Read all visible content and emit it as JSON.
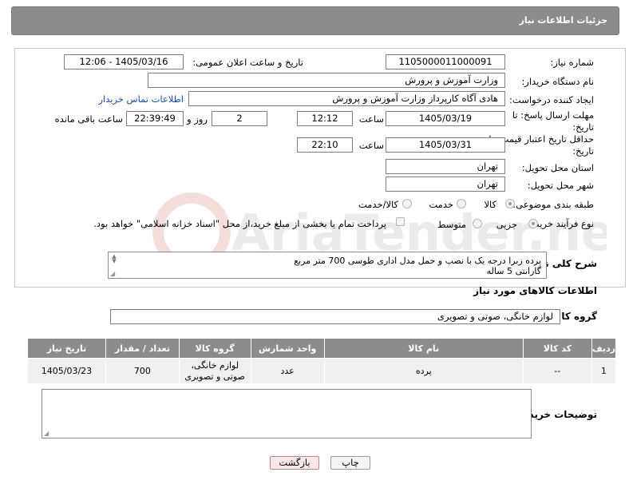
{
  "header": {
    "title": "جزئیات اطلاعات نیاز"
  },
  "form": {
    "need_number_label": "شماره نیاز:",
    "need_number": "1105000011000091",
    "announce_label": "تاریخ و ساعت اعلان عمومی:",
    "announce_value": "1405/03/16 - 12:06",
    "buyer_org_label": "نام دستگاه خریدار:",
    "buyer_org": "وزارت آموزش و پرورش",
    "creator_label": "ایجاد کننده درخواست:",
    "creator": "هادی آگاه کارپرداز وزارت آموزش و پرورش",
    "contact_link": "اطلاعات تماس خریدار",
    "reply_deadline_label": "مهلت ارسال پاسخ: تا تاریخ:",
    "reply_date": "1405/03/19",
    "time_label": "ساعت",
    "reply_time": "12:12",
    "days": "2",
    "days_label": "روز و",
    "remaining_time": "22:39:49",
    "remaining_label": "ساعت باقی مانده",
    "price_validity_label": "حداقل تاریخ اعتبار قیمت: تا تاریخ:",
    "price_date": "1405/03/31",
    "price_time": "22:10",
    "province_label": "استان محل تحویل:",
    "province": "تهران",
    "city_label": "شهر محل تحویل:",
    "city": "تهران",
    "category_label": "طبقه بندی موضوعی:",
    "category_options": [
      "کالا",
      "خدمت",
      "کالا/خدمت"
    ],
    "category_selected": "کالا",
    "process_label": "نوع فرآیند خرید :",
    "process_options": [
      "جزیی",
      "متوسط"
    ],
    "process_selected": "جزیی",
    "payment_note": "پرداخت تمام یا بخشی از مبلغ خرید،از محل \"اسناد خزانه اسلامی\" خواهد بود."
  },
  "description": {
    "label": "شرح کلی نیاز:",
    "line1": "پرده زبرا  درجه یک با نصب و حمل مدل اداری طوسی 700 متر مربع",
    "line2": "گارانتی 5 ساله"
  },
  "goods": {
    "section_title": "اطلاعات کالاهای مورد نیاز",
    "group_label": "گروه کالا:",
    "group_value": "لوازم خانگی، صوتی و تصویری",
    "columns": [
      "ردیف",
      "کد کالا",
      "نام کالا",
      "واحد شمارش",
      "گروه کالا",
      "تعداد / مقدار",
      "تاریخ نیاز"
    ],
    "rows": [
      {
        "row": "1",
        "code": "--",
        "name": "پرده",
        "unit": "عدد",
        "group": "لوازم خانگی، صوتی و تصویری",
        "qty": "700",
        "date": "1405/03/23"
      }
    ]
  },
  "buyer_notes_label": "توضیحات خریدار:",
  "buttons": {
    "print": "چاپ",
    "back": "بازگشت"
  },
  "watermark": "AriaTender.neT"
}
